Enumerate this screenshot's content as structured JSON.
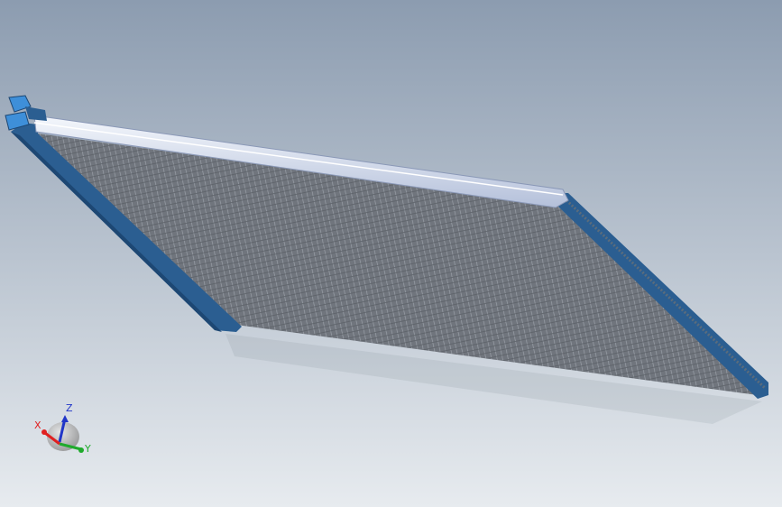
{
  "viewport": {
    "background_top": "#8c9cb0",
    "background_bottom": "#e7ebef"
  },
  "model": {
    "core_color": "#727880",
    "frame_color": "#2b5e91",
    "frame_shadow": "#1d4773",
    "tank_color": "#dfe6f4",
    "tank_edge": "#8a98b7",
    "tab_color": "#3e8fd9"
  },
  "triad": {
    "x_label": "X",
    "y_label": "Y",
    "z_label": "Z",
    "x_color": "#e02020",
    "y_color": "#1faa2c",
    "z_color": "#2136c8"
  }
}
